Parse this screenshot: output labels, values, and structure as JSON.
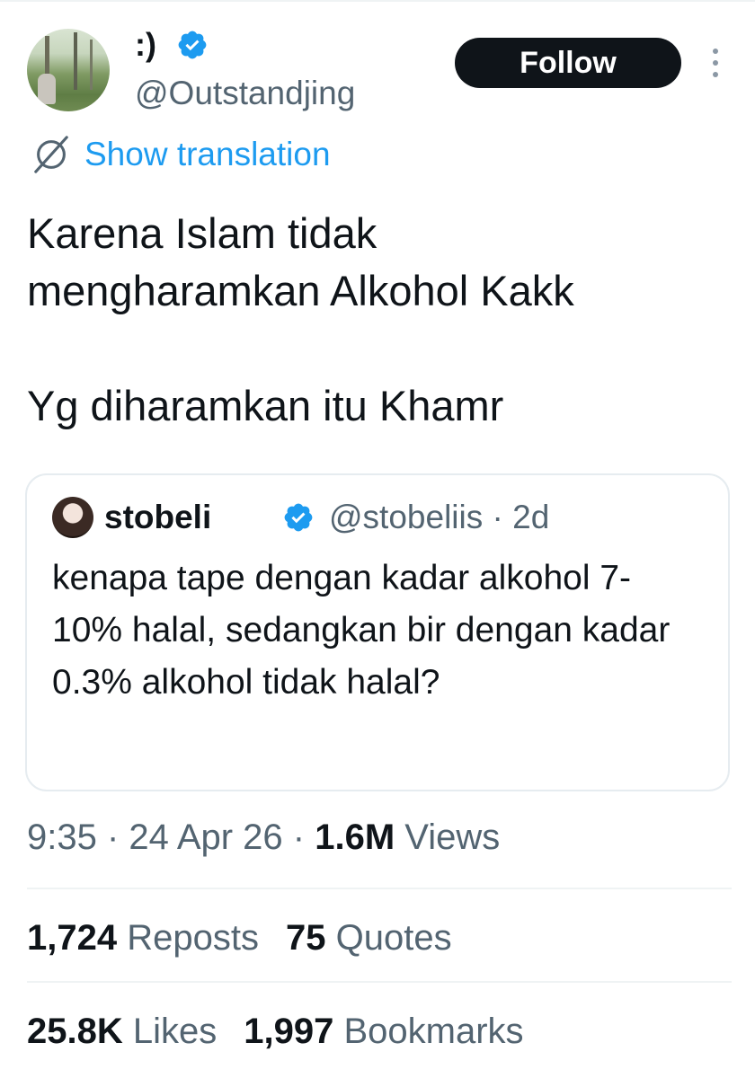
{
  "author": {
    "display_name": ":)",
    "handle": "@Outstandjing",
    "verified_icon": "verified-badge-icon",
    "follow_label": "Follow"
  },
  "translation": {
    "label": "Show translation",
    "icon": "translate-icon"
  },
  "tweet": {
    "text": "Karena Islam tidak\nmengharamkan Alkohol Kakk\n\nYg diharamkan itu Khamr"
  },
  "quote": {
    "display_name": "stobeli",
    "handle": "@stobeliis",
    "time": "· 2d",
    "text": "kenapa tape dengan kadar alkohol 7-10% halal, sedangkan bir dengan kadar 0.3% alkohol tidak halal?"
  },
  "meta": {
    "time": "9:35",
    "date": "24 Apr 26",
    "views_count": "1.6M",
    "views_label": "Views"
  },
  "stats": {
    "reposts_count": "1,724",
    "reposts_label": "Reposts",
    "quotes_count": "75",
    "quotes_label": "Quotes",
    "likes_count": "25.8K",
    "likes_label": "Likes",
    "bookmarks_count": "1,997",
    "bookmarks_label": "Bookmarks"
  },
  "colors": {
    "link_blue": "#1d9bf0",
    "text_primary": "#0f1419",
    "text_secondary": "#536471",
    "follow_bg": "#0f1419"
  }
}
